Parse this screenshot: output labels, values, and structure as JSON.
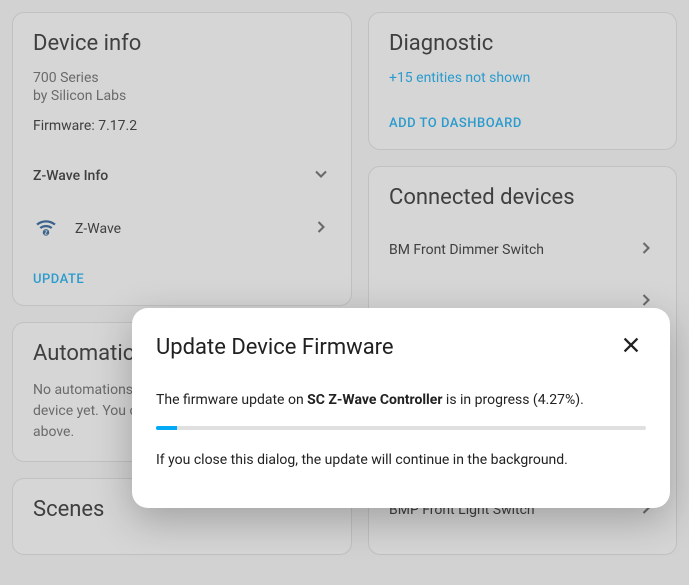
{
  "device_info": {
    "title": "Device info",
    "series": "700 Series",
    "vendor": "by Silicon Labs",
    "firmware": "Firmware: 7.17.2",
    "zwave_info_label": "Z-Wave Info",
    "integration_name": "Z-Wave",
    "update_label": "UPDATE"
  },
  "automations": {
    "title": "Automations",
    "text": "No automations have been set up for this device yet. You can set one up using the button above."
  },
  "scenes": {
    "title": "Scenes"
  },
  "diagnostic": {
    "title": "Diagnostic",
    "entities_link": "+15 entities not shown",
    "dashboard_label": "ADD TO DASHBOARD"
  },
  "connected": {
    "title": "Connected devices",
    "items": [
      "BM Front Dimmer Switch",
      "",
      "",
      "",
      "",
      "BMP Front Light Switch"
    ]
  },
  "dialog": {
    "title": "Update Device Firmware",
    "prefix": "The firmware update on ",
    "device": "SC Z-Wave Controller",
    "suffix": " is in progress (4.27%).",
    "progress_percent": 4.27,
    "note": "If you close this dialog, the update will continue in the background."
  }
}
